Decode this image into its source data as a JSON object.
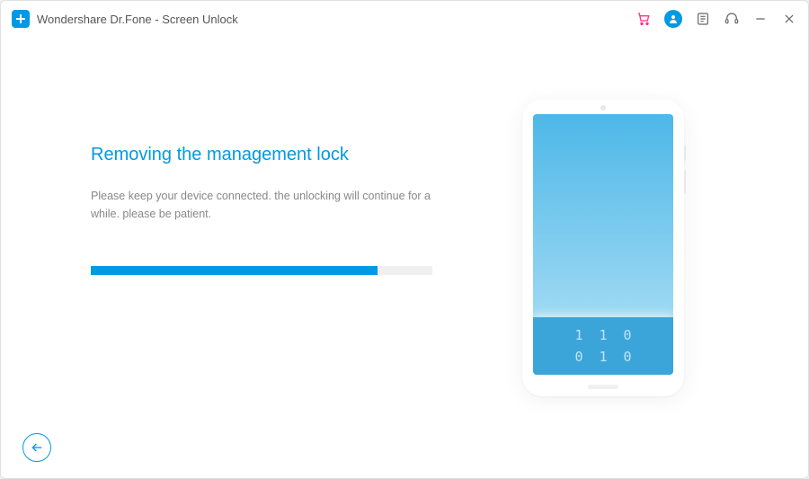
{
  "app": {
    "title": "Wondershare Dr.Fone - Screen Unlock"
  },
  "main": {
    "heading": "Removing the management lock",
    "subtext": "Please keep your device connected. the unlocking will continue for a while. please be patient.",
    "progress_percent": 84
  },
  "phone": {
    "keypad_row1": "110",
    "keypad_row2": "010"
  },
  "colors": {
    "accent": "#0099e5",
    "text_muted": "#888888"
  }
}
